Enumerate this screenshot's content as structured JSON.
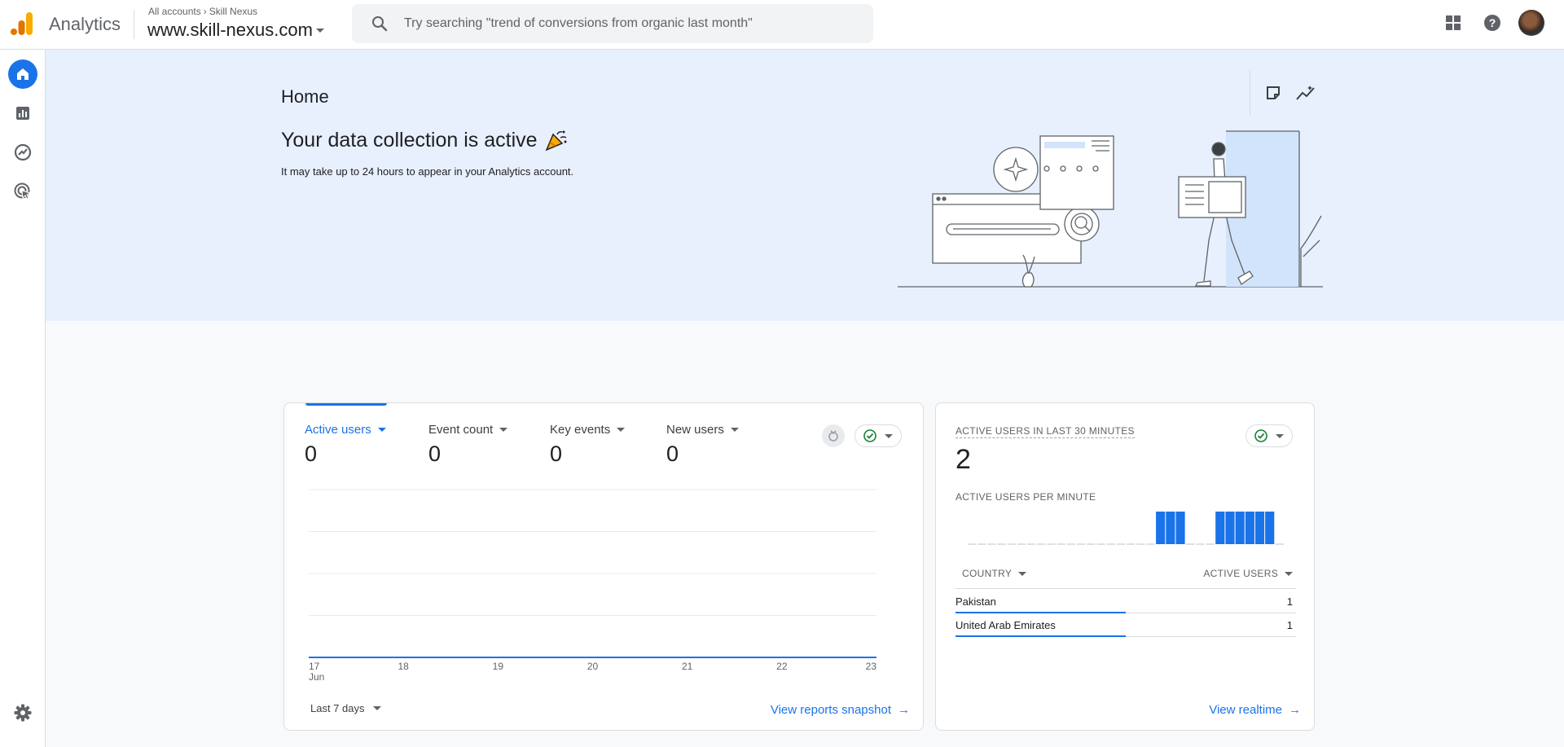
{
  "header": {
    "app_name": "Analytics",
    "breadcrumb_root": "All accounts",
    "breadcrumb_account": "Skill Nexus",
    "property_name": "www.skill-nexus.com",
    "search_placeholder": "Try searching \"trend of conversions from organic last month\""
  },
  "nav": {
    "items": [
      "Home",
      "Reports",
      "Explore",
      "Advertising"
    ],
    "settings": "Admin"
  },
  "hero": {
    "page_title": "Home",
    "headline": "Your data collection is active",
    "subtext": "It may take up to 24 hours to appear in your Analytics account."
  },
  "overview_card": {
    "metrics": [
      {
        "label": "Active users",
        "value": "0"
      },
      {
        "label": "Event count",
        "value": "0"
      },
      {
        "label": "Key events",
        "value": "0"
      },
      {
        "label": "New users",
        "value": "0"
      }
    ],
    "date_range": "Last 7 days",
    "link": "View reports snapshot"
  },
  "chart_data": {
    "type": "line",
    "x": [
      "17 Jun",
      "18",
      "19",
      "20",
      "21",
      "22",
      "23"
    ],
    "x_tick_labels": [
      "17",
      "18",
      "19",
      "20",
      "21",
      "22",
      "23"
    ],
    "x_month_label": "Jun",
    "series": [
      {
        "values": [
          0,
          0,
          0,
          0,
          0,
          0,
          0
        ]
      }
    ],
    "ylim": [
      0,
      4
    ],
    "grid": true,
    "color": "#1a73e8"
  },
  "realtime_card": {
    "title": "ACTIVE USERS IN LAST 30 MINUTES",
    "value": "2",
    "per_minute_label": "ACTIVE USERS PER MINUTE",
    "per_minute": [
      0,
      0,
      0,
      0,
      0,
      0,
      0,
      0,
      0,
      0,
      0,
      0,
      0,
      0,
      0,
      0,
      0,
      0,
      0,
      1,
      1,
      1,
      0,
      0,
      0,
      1,
      1,
      1,
      1,
      1,
      1,
      0
    ],
    "col_country": "COUNTRY",
    "col_users": "ACTIVE USERS",
    "rows": [
      {
        "country": "Pakistan",
        "users": "1",
        "share": 0.5
      },
      {
        "country": "United Arab Emirates",
        "users": "1",
        "share": 0.5
      }
    ],
    "link": "View realtime"
  },
  "colors": {
    "accent": "#1a73e8",
    "hero_bg": "#e8f0fe",
    "success": "#188038"
  }
}
